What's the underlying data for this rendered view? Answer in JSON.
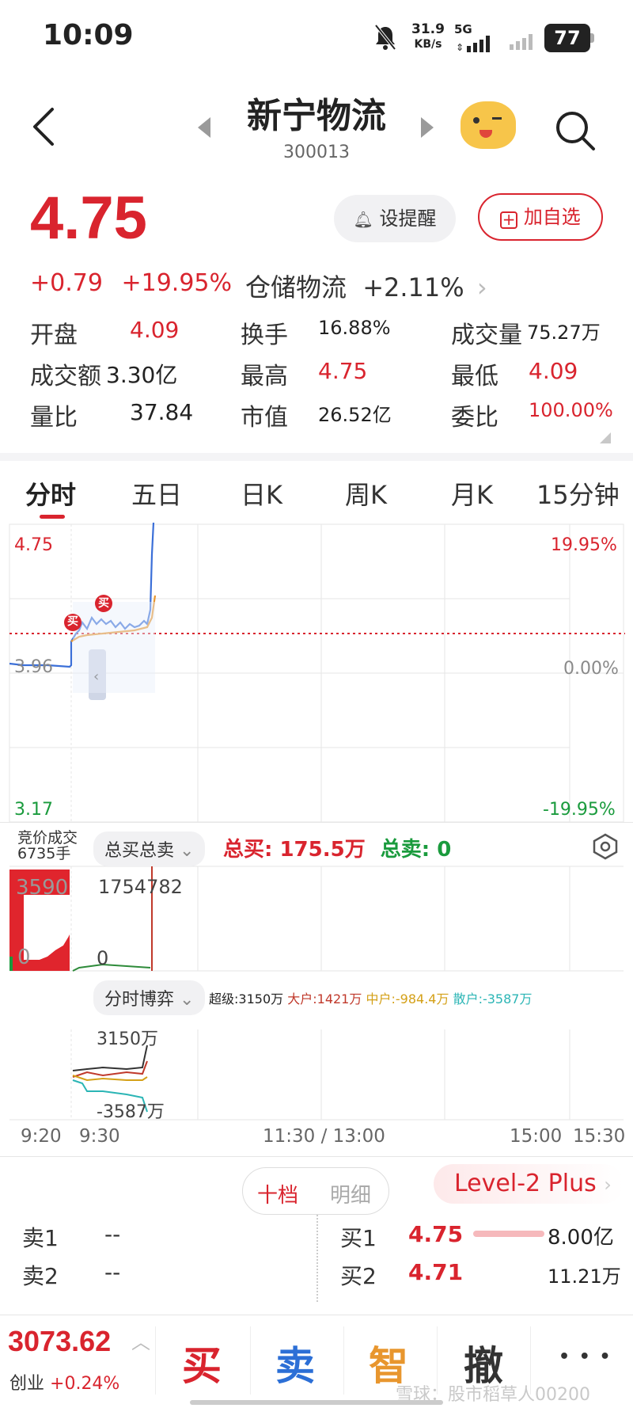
{
  "status_bar": {
    "time": "10:09",
    "net_speed_value": "31.9",
    "net_speed_unit": "KB/s",
    "network": "5G",
    "battery": "77"
  },
  "header": {
    "stock_name": "新宁物流",
    "stock_code": "300013"
  },
  "quote": {
    "price": "4.75",
    "change": "+0.79",
    "change_pct": "+19.95%",
    "remind_label": "设提醒",
    "add_fav_label": "加自选",
    "sector_name": "仓储物流",
    "sector_change": "+2.11%",
    "stats": [
      {
        "label": "开盘",
        "value": "4.09",
        "color": "red"
      },
      {
        "label": "换手",
        "value": "16.88%",
        "color": "black"
      },
      {
        "label": "成交量",
        "value": "75.27万",
        "color": "black"
      },
      {
        "label": "成交额",
        "value": "3.30亿",
        "color": "black"
      },
      {
        "label": "最高",
        "value": "4.75",
        "color": "red"
      },
      {
        "label": "最低",
        "value": "4.09",
        "color": "red"
      },
      {
        "label": "量比",
        "value": "37.84",
        "color": "black"
      },
      {
        "label": "市值",
        "value": "26.52亿",
        "color": "black"
      },
      {
        "label": "委比",
        "value": "100.00%",
        "color": "red"
      }
    ]
  },
  "tabs": [
    "分时",
    "五日",
    "日K",
    "周K",
    "月K",
    "15分钟"
  ],
  "intraday_chart": {
    "y_top_price": "4.75",
    "y_mid_price": "3.96",
    "y_bottom_price": "3.17",
    "y_top_pct": "19.95%",
    "y_mid_pct": "0.00%",
    "y_bottom_pct": "-19.95%",
    "buy_marker": "买"
  },
  "auction": {
    "title": "竞价成交",
    "volume": "6735手",
    "dropdown": "总买总卖",
    "total_buy_label": "总买:",
    "total_buy_value": "175.5万",
    "total_sell_label": "总卖:",
    "total_sell_value": "0",
    "left_max": "3590",
    "left_min": "0",
    "right_max": "1754782",
    "right_min": "0"
  },
  "flow": {
    "dropdown": "分时博弈",
    "super_label": "超级:",
    "super_value": "3150万",
    "large_label": "大户:",
    "large_value": "1421万",
    "mid_label": "中户:",
    "mid_value": "-984.4万",
    "retail_label": "散户:",
    "retail_value": "-3587万",
    "y_max": "3150万",
    "y_min": "-3587万",
    "colors": {
      "super": "#333333",
      "large": "#c0392b",
      "mid": "#d4a017",
      "retail": "#2bb5b5"
    }
  },
  "time_axis": [
    "9:20",
    "9:30",
    "11:30 / 13:00",
    "15:00",
    "15:30"
  ],
  "order_book": {
    "tab_active": "十档",
    "tab_inactive": "明细",
    "level2": "Level-2 Plus",
    "sell": [
      {
        "label": "卖1",
        "price": "--"
      },
      {
        "label": "卖2",
        "price": "--"
      }
    ],
    "buy": [
      {
        "label": "买1",
        "price": "4.75",
        "volume": "8.00亿"
      },
      {
        "label": "买2",
        "price": "4.71",
        "volume": "11.21万"
      }
    ]
  },
  "bottom_bar": {
    "index_value": "3073.62",
    "index_name": "创业",
    "index_change": "+0.24%",
    "buy": "买",
    "sell": "卖",
    "smart": "智",
    "cancel": "撤",
    "more": "• • •",
    "watermark": "雪球：股市稻草人00200"
  },
  "accent_colors": {
    "up": "#d9242e",
    "down": "#1a9b3d",
    "blue": "#3b6fd8",
    "orange": "#e8962e"
  }
}
